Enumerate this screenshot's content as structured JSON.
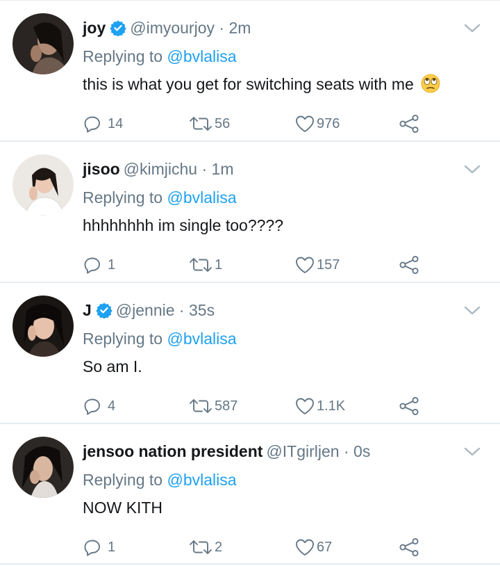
{
  "tweets": [
    {
      "name": "joy",
      "verified": true,
      "handle": "@imyourjoy",
      "time": "2m",
      "reply_prefix": "Replying to",
      "reply_to": "@bvlalisa",
      "text": "this is what you get for switching seats with me",
      "emoji": "face-with-rolling-eyes",
      "replies": "14",
      "retweets": "56",
      "likes": "976"
    },
    {
      "name": "jisoo",
      "verified": false,
      "handle": "@kimjichu",
      "time": "1m",
      "reply_prefix": "Replying to",
      "reply_to": "@bvlalisa",
      "text": "hhhhhhhh im single too????",
      "replies": "1",
      "retweets": "1",
      "likes": "157"
    },
    {
      "name": "J",
      "verified": true,
      "handle": "@jennie",
      "time": "35s",
      "reply_prefix": "Replying to",
      "reply_to": "@bvlalisa",
      "text": "So am I.",
      "replies": "4",
      "retweets": "587",
      "likes": "1.1K"
    },
    {
      "name": "jensoo nation president",
      "verified": false,
      "handle": "@ITgirljen",
      "time": "0s",
      "reply_prefix": "Replying to",
      "reply_to": "@bvlalisa",
      "text": "NOW KITH",
      "replies": "1",
      "retweets": "2",
      "likes": "67"
    }
  ],
  "colors": {
    "accent": "#1da1f2",
    "muted": "#657786",
    "divider": "#e6ecf0"
  }
}
